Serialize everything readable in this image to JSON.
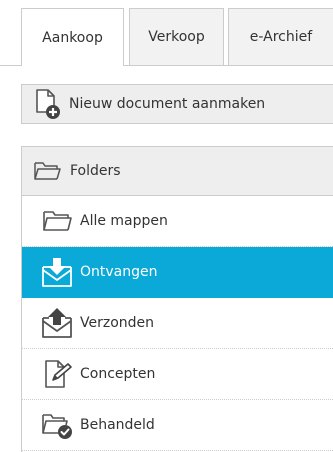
{
  "tabs": [
    {
      "label": "Aankoop",
      "active": true
    },
    {
      "label": "Verkoop",
      "active": false
    },
    {
      "label": "e-Archief",
      "active": false
    }
  ],
  "new_document": {
    "label": "Nieuw document aanmaken",
    "icon": "new-document-icon"
  },
  "folders": {
    "header_label": "Folders",
    "header_icon": "folder-icon",
    "items": [
      {
        "label": "Alle mappen",
        "icon": "folder-icon",
        "active": false
      },
      {
        "label": "Ontvangen",
        "icon": "inbox-download-icon",
        "active": true
      },
      {
        "label": "Verzonden",
        "icon": "outbox-upload-icon",
        "active": false
      },
      {
        "label": "Concepten",
        "icon": "draft-edit-icon",
        "active": false
      },
      {
        "label": "Behandeld",
        "icon": "folder-check-icon",
        "active": false
      }
    ]
  },
  "colors": {
    "accent": "#0aa9d8",
    "tab_inactive_bg": "#f2f2f2",
    "panel_header_bg": "#eeeeee",
    "border": "#cccccc",
    "text": "#333333"
  }
}
